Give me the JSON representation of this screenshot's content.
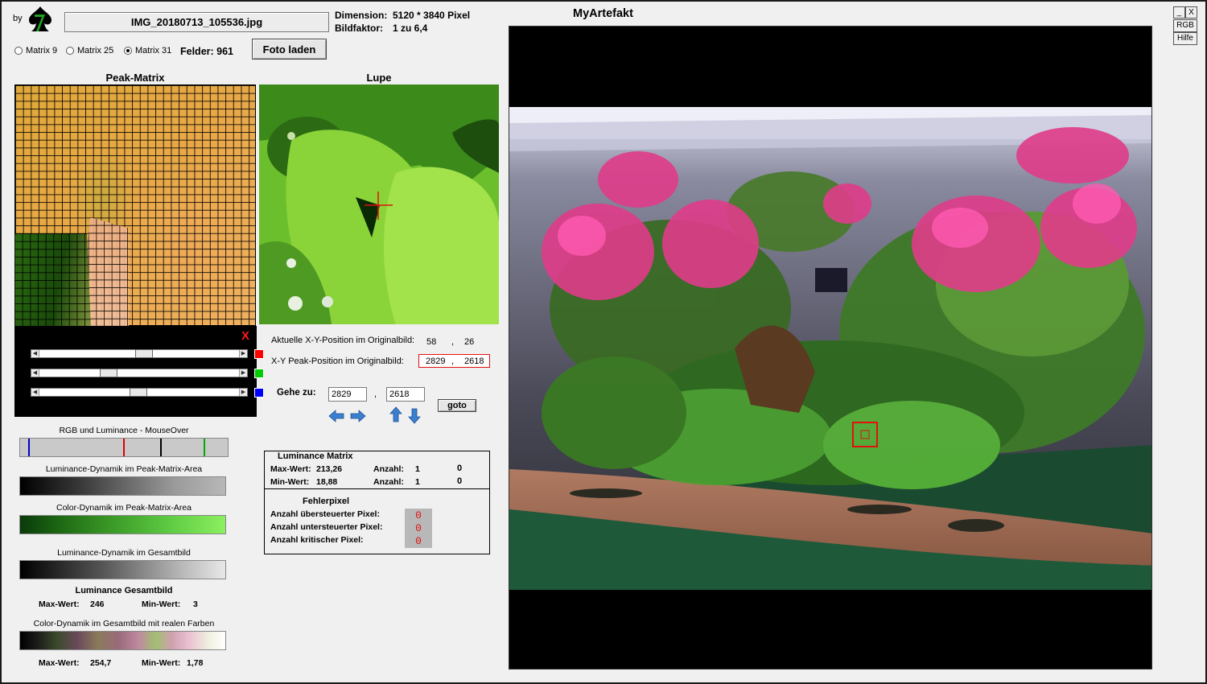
{
  "header": {
    "by_label": "by",
    "filename": "IMG_20180713_105536.jpg",
    "dimension_label": "Dimension:",
    "dimension_value": "5120 * 3840 Pixel",
    "bildfaktor_label": "Bildfaktor:",
    "bildfaktor_value": "1 zu 6,4",
    "app_title": "MyArtefakt"
  },
  "matrix_options": [
    {
      "label": "Matrix 9",
      "selected": false
    },
    {
      "label": "Matrix 25",
      "selected": false
    },
    {
      "label": "Matrix 31",
      "selected": true
    }
  ],
  "felder": "Felder: 961",
  "foto_button": "Foto laden",
  "peak_matrix_title": "Peak-Matrix",
  "lupe_title": "Lupe",
  "close_mark": "X",
  "sliders": [
    {
      "color": "#ff0000",
      "value": 0.52
    },
    {
      "color": "#00cc00",
      "value": 0.33
    },
    {
      "color": "#0000ff",
      "value": 0.49
    }
  ],
  "position": {
    "aktuelle_label": "Aktuelle X-Y-Position  im Originalbild:",
    "aktuelle_x": "58",
    "aktuelle_y": "26",
    "separator": ",",
    "peak_label": "X-Y Peak-Position  im Originalbild:",
    "peak_x": "2829",
    "peak_y": "2618"
  },
  "goto": {
    "label": "Gehe zu:",
    "x": "2829",
    "y": "2618",
    "button": "goto"
  },
  "bars": {
    "rgb_label": "RGB und Luminance - MouseOver",
    "lum_peak_label": "Luminance-Dynamik im Peak-Matrix-Area",
    "col_peak_label": "Color-Dynamik im Peak-Matrix-Area",
    "lum_all_label": "Luminance-Dynamik im Gesamtbild",
    "col_all_label": "Color-Dynamik im Gesamtbild mit realen Farben"
  },
  "rgb_markers": [
    {
      "color": "#0000cc",
      "value": 0.04
    },
    {
      "color": "#dd0000",
      "value": 0.5
    },
    {
      "color": "#000000",
      "value": 0.68
    },
    {
      "color": "#00aa00",
      "value": 0.89
    }
  ],
  "luminance_gesamt": {
    "title": "Luminance Gesamtbild",
    "max_label": "Max-Wert:",
    "max_value": "246",
    "min_label": "Min-Wert:",
    "min_value": "3"
  },
  "color_gesamt": {
    "max_label": "Max-Wert:",
    "max_value": "254,7",
    "min_label": "Min-Wert:",
    "min_value": "1,78"
  },
  "luminance_matrix": {
    "title": "Luminance Matrix",
    "max_label": "Max-Wert:",
    "max_value": "213,26",
    "min_label": "Min-Wert:",
    "min_value": "18,88",
    "anzahl_label": "Anzahl:",
    "anzahl_max": "1",
    "anzahl_min": "1",
    "extra_max": "0",
    "extra_min": "0"
  },
  "fehlerpixel": {
    "title": "Fehlerpixel",
    "ueber_label": "Anzahl übersteuerter Pixel:",
    "unter_label": "Anzahl untersteuerter Pixel:",
    "krit_label": "Anzahl kritischer Pixel:",
    "ueber": "0",
    "unter": "0",
    "krit": "0"
  },
  "window": {
    "minimize": "_",
    "close": "X",
    "rgb": "RGB",
    "hilfe": "Hilfe"
  },
  "colors": {
    "accent_red": "#e21010",
    "panel_bg": "#f0f0f0"
  }
}
